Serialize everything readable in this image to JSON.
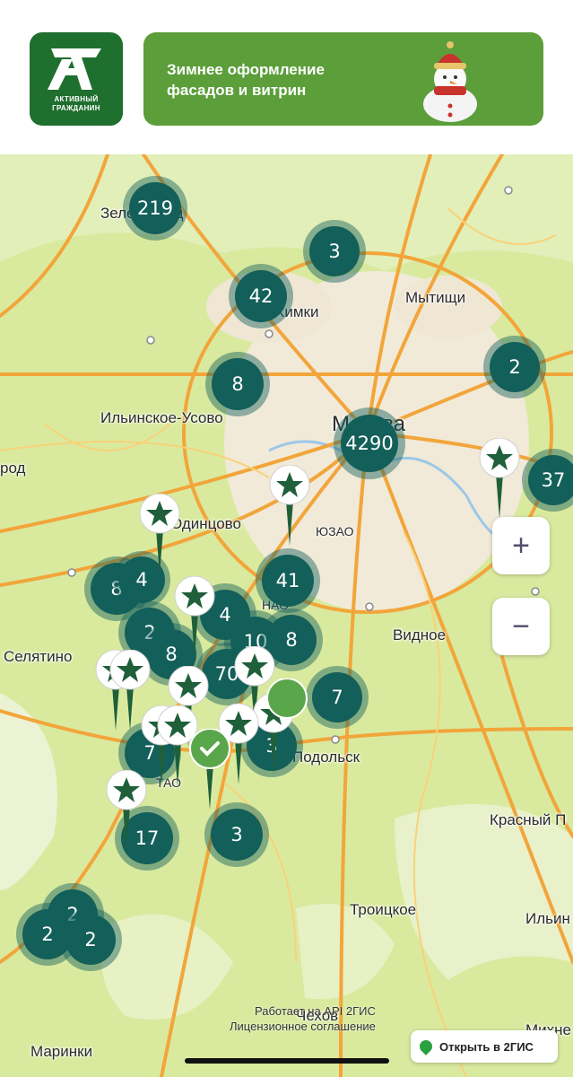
{
  "header": {
    "logo_caption_line1": "АКТИВНЫЙ",
    "logo_caption_line2": "ГРАЖДАНИН",
    "banner_text": "Зимнее оформление фасадов и витрин"
  },
  "map": {
    "places": {
      "zelenograd": "Зеленоград",
      "khimki": "Химки",
      "mytishchi": "Мытищи",
      "ilinskoe": "Ильинское-Усово",
      "moskva": "Москва",
      "odintsovo": "Одинцово",
      "yuzao": "ЮЗАО",
      "nao": "НАО",
      "selyatino": "Селятино",
      "vidnoe": "Видное",
      "podolsk": "Подольск",
      "tao": "ТАО",
      "krasny": "Красный П",
      "troitskoe": "Троицкое",
      "ilyin": "Ильин",
      "chekhov": "Чехов",
      "marinki": "Маринки",
      "mikhn": "Михне",
      "gorod": "род"
    },
    "clusters": [
      "219",
      "3",
      "42",
      "2",
      "8",
      "4290",
      "37",
      "8",
      "4",
      "41",
      "4",
      "2",
      "8",
      "10",
      "8",
      "70",
      "7",
      "7",
      "3",
      "17",
      "3",
      "2",
      "2",
      "2"
    ]
  },
  "controls": {
    "zoom_in": "+",
    "zoom_out": "−",
    "attribution_line1": "Работает на API 2ГИС",
    "attribution_line2": "Лицензионное соглашение",
    "open_2gis": "Открыть в 2ГИС"
  },
  "colors": {
    "brand_green": "#1f6f2e",
    "banner_green": "#5b9e3a",
    "cluster_teal": "#135f5a",
    "pin_green": "#1f5f3a",
    "done_green": "#5aa64a"
  },
  "icons": {
    "pin": "star-pin-icon",
    "done": "check-pin-icon"
  }
}
